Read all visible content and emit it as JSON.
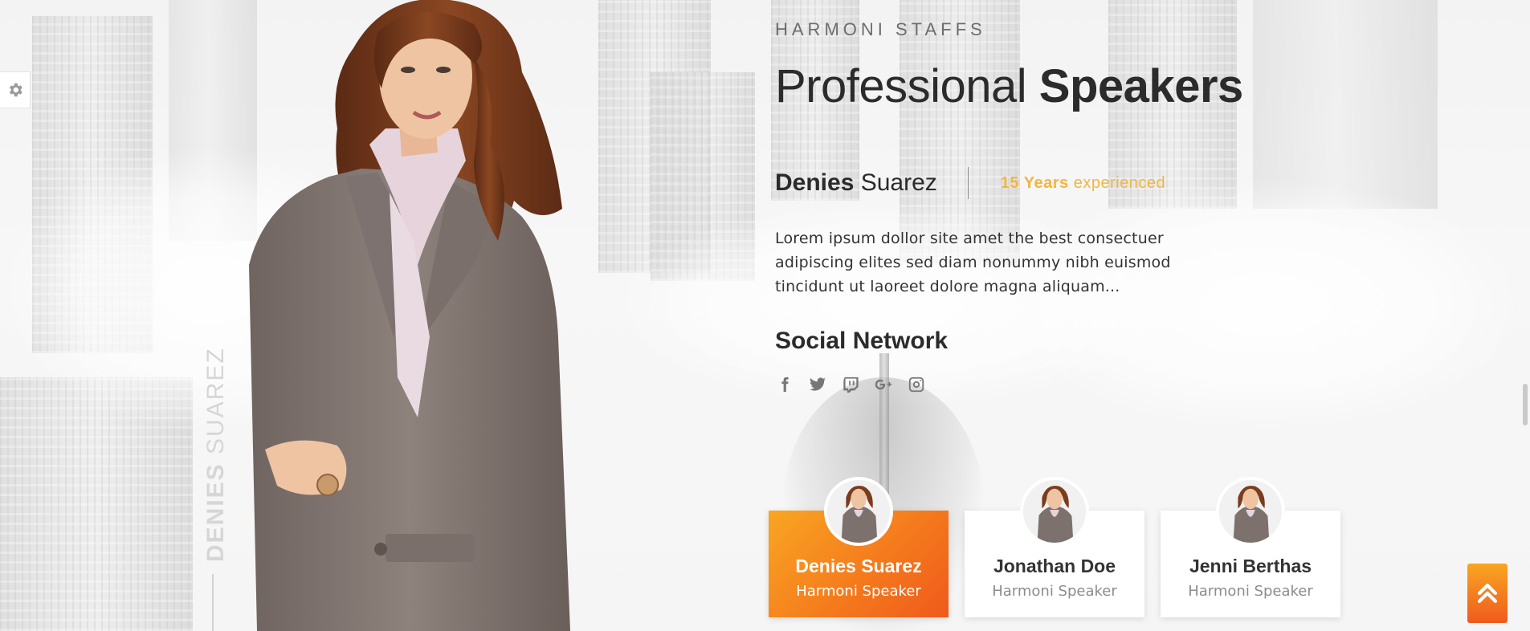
{
  "section": {
    "eyebrow": "HARMONI STAFFS",
    "headline_light": "Professional",
    "headline_bold": "Speakers"
  },
  "speaker": {
    "first_name": "Denies",
    "last_name": "Suarez",
    "vertical_first": "DENIES",
    "vertical_last": "SUAREZ",
    "experience_bold": "15 Years",
    "experience_rest": "experienced",
    "description": "Lorem ipsum dollor site amet the best consectuer adipiscing elites sed diam nonummy nibh euismod tincidunt ut laoreet dolore magna aliquam..."
  },
  "social": {
    "title": "Social Network",
    "icons": [
      "facebook-icon",
      "twitter-icon",
      "twitch-icon",
      "google-plus-icon",
      "instagram-icon"
    ]
  },
  "cards": [
    {
      "name": "Denies Suarez",
      "role": "Harmoni Speaker",
      "active": true
    },
    {
      "name": "Jonathan Doe",
      "role": "Harmoni Speaker",
      "active": false
    },
    {
      "name": "Jenni Berthas",
      "role": "Harmoni Speaker",
      "active": false
    }
  ],
  "colors": {
    "accent_orange": "#f4771c",
    "accent_yellow": "#f3b63d",
    "text_dark": "#2b2b2b"
  }
}
